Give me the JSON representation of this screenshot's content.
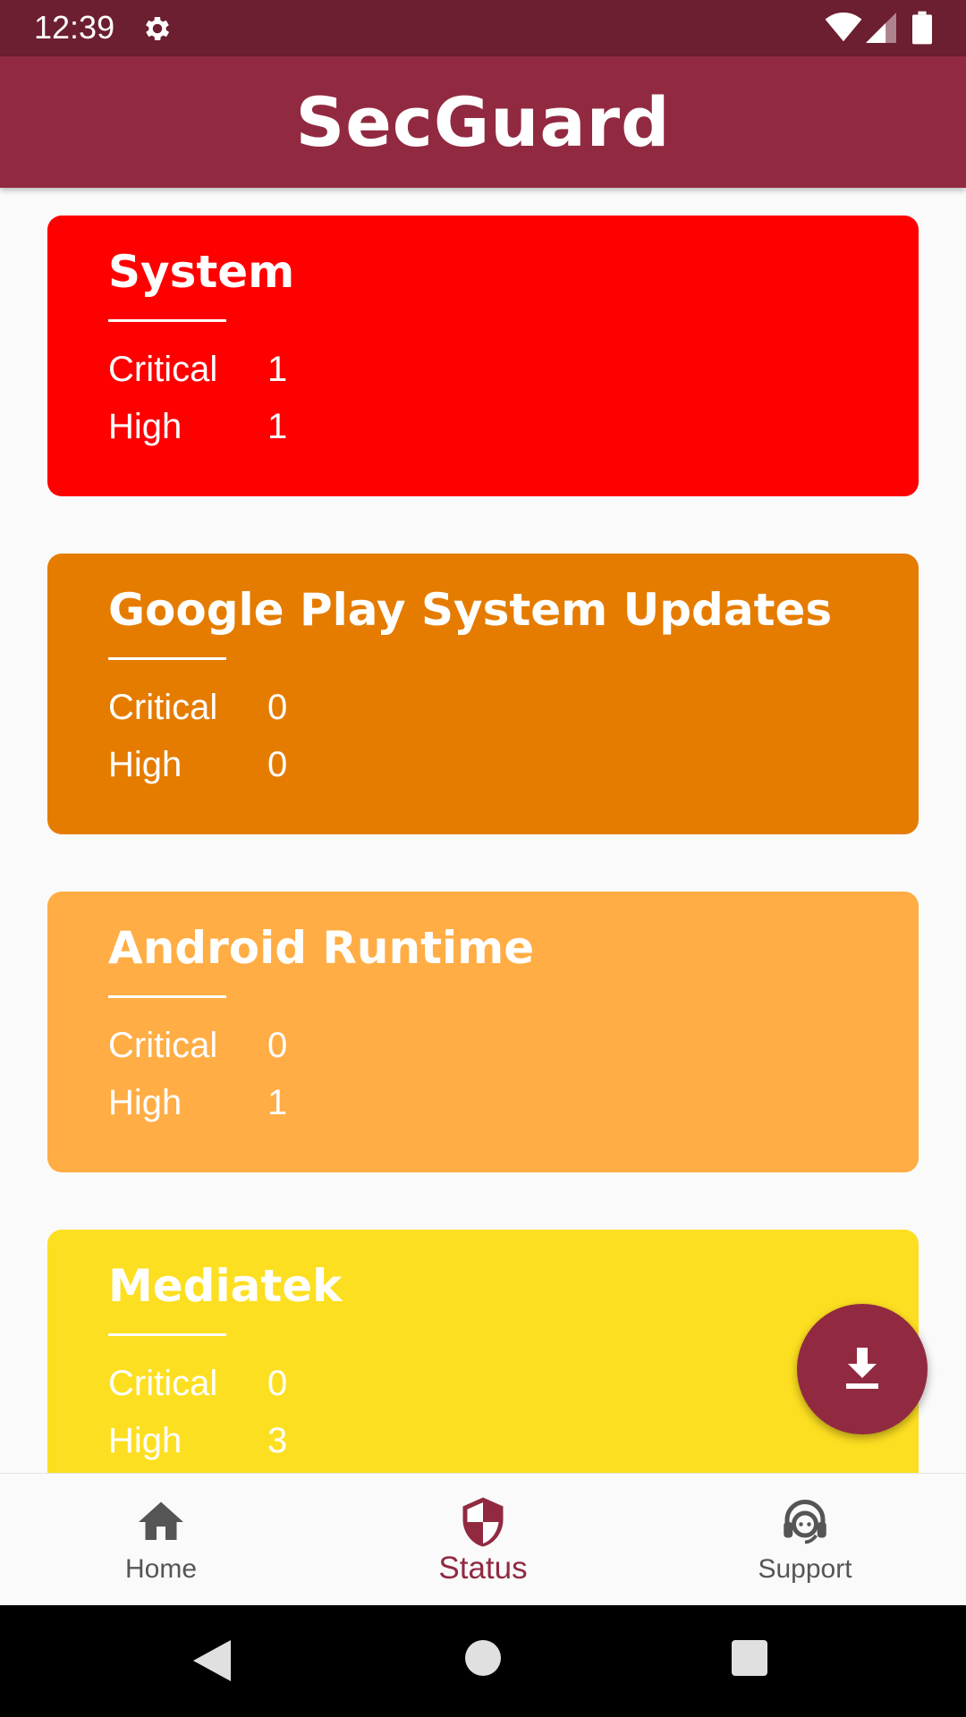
{
  "status_bar": {
    "time": "12:39",
    "icons": [
      "gear-icon",
      "wifi-icon",
      "signal-icon",
      "battery-icon"
    ]
  },
  "app": {
    "title": "SecGuard",
    "accent_color": "#912a41"
  },
  "cards": [
    {
      "title": "System",
      "color": "#ff0000",
      "rows": [
        {
          "label": "Critical",
          "value": "1"
        },
        {
          "label": "High",
          "value": "1"
        }
      ]
    },
    {
      "title": "Google Play System Updates",
      "color": "#e57c00",
      "rows": [
        {
          "label": "Critical",
          "value": "0"
        },
        {
          "label": "High",
          "value": "0"
        }
      ]
    },
    {
      "title": "Android Runtime",
      "color": "#ffad44",
      "rows": [
        {
          "label": "Critical",
          "value": "0"
        },
        {
          "label": "High",
          "value": "1"
        }
      ]
    },
    {
      "title": "Mediatek",
      "color": "#fddf21",
      "rows": [
        {
          "label": "Critical",
          "value": "0"
        },
        {
          "label": "High",
          "value": "3"
        }
      ]
    }
  ],
  "fab": {
    "icon": "download-icon"
  },
  "bottom_nav": {
    "items": [
      {
        "label": "Home",
        "icon": "home-icon",
        "active": false
      },
      {
        "label": "Status",
        "icon": "shield-icon",
        "active": true
      },
      {
        "label": "Support",
        "icon": "headset-icon",
        "active": false
      }
    ]
  },
  "system_nav": {
    "icons": [
      "back-icon",
      "home-circle-icon",
      "recents-icon"
    ]
  }
}
